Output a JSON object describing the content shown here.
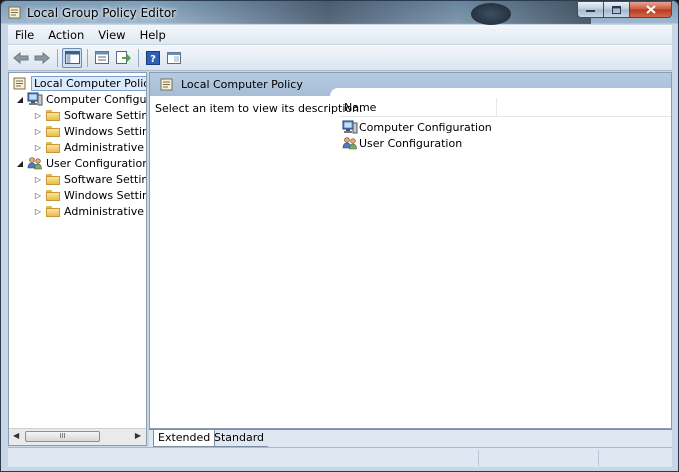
{
  "window": {
    "title": "Local Group Policy Editor"
  },
  "menu": [
    "File",
    "Action",
    "View",
    "Help"
  ],
  "toolbar": {
    "buttons": [
      "back-icon",
      "forward-icon",
      "show-hide-tree-icon",
      "properties-icon",
      "export-list-icon",
      "help-icon",
      "extended-view-icon"
    ]
  },
  "tree": {
    "root": "Local Computer Policy",
    "items": [
      {
        "label": "Computer Configura",
        "level": 1,
        "expanded": true,
        "icon": "computer-icon"
      },
      {
        "label": "Software Settings",
        "level": 2,
        "expanded": false,
        "icon": "folder-icon"
      },
      {
        "label": "Windows Setting",
        "level": 2,
        "expanded": false,
        "icon": "folder-icon"
      },
      {
        "label": "Administrative Te",
        "level": 2,
        "expanded": false,
        "icon": "folder-icon"
      },
      {
        "label": "User Configuration",
        "level": 1,
        "expanded": true,
        "icon": "users-icon"
      },
      {
        "label": "Software Settings",
        "level": 2,
        "expanded": false,
        "icon": "folder-icon"
      },
      {
        "label": "Windows Setting",
        "level": 2,
        "expanded": false,
        "icon": "folder-icon"
      },
      {
        "label": "Administrative Te",
        "level": 2,
        "expanded": false,
        "icon": "folder-icon"
      }
    ],
    "scroll_thumb": "III"
  },
  "main": {
    "header": "Local Computer Policy",
    "description": "Select an item to view its description.",
    "columns": [
      "Name"
    ],
    "rows": [
      {
        "label": "Computer Configuration",
        "icon": "computer-icon"
      },
      {
        "label": "User Configuration",
        "icon": "users-icon"
      }
    ]
  },
  "tabs": {
    "extended": "Extended",
    "standard": "Standard",
    "active": "Extended"
  }
}
